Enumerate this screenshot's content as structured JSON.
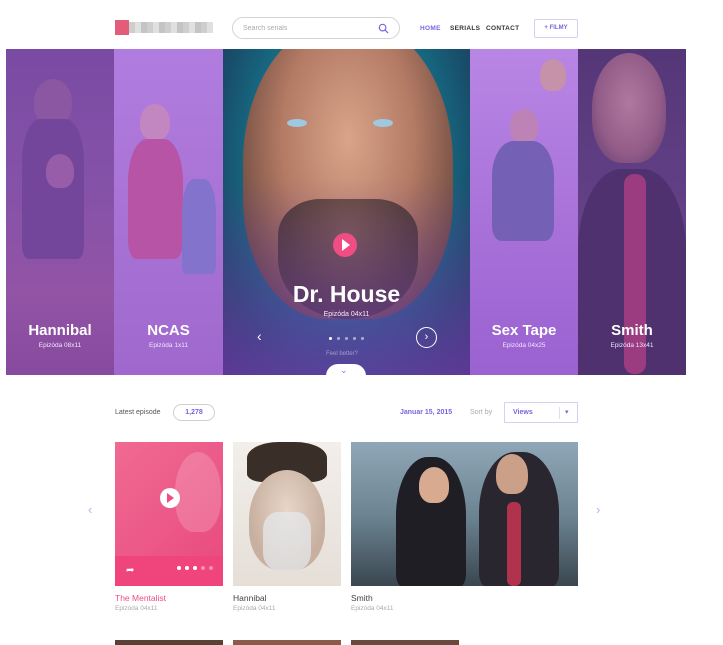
{
  "header": {
    "search_placeholder": "Search serials",
    "nav": [
      {
        "label": "HOME",
        "active": true
      },
      {
        "label": "SERIALS",
        "active": false
      },
      {
        "label": "CONTACT",
        "active": false
      }
    ],
    "filmy_button": "+ FILMY"
  },
  "hero": {
    "slides": [
      {
        "title": "Hannibal",
        "episode": "Epizóda 08x11"
      },
      {
        "title": "NCAS",
        "episode": "Epizóda 1x11"
      },
      {
        "title": "Dr. House",
        "episode": "Epizóda 04x11"
      },
      {
        "title": "Sex Tape",
        "episode": "Epizóda 04x25"
      },
      {
        "title": "Smith",
        "episode": "Epizóda 13x41"
      }
    ],
    "feel_text": "Feel better?",
    "active_dot": 1,
    "dot_count": 5
  },
  "toolbar": {
    "latest_label": "Latest episode",
    "latest_count": "1,278",
    "date": "Januar 15, 2015",
    "sort_label": "Sort by",
    "sort_value": "Views"
  },
  "cards": [
    {
      "title": "The Mentalist",
      "episode": "Epizóda 04x11",
      "rating": 3,
      "rating_max": 5
    },
    {
      "title": "Hannibal",
      "episode": "Epizóda 04x11"
    },
    {
      "title": "Smith",
      "episode": "Epizóda 04x11"
    }
  ],
  "colors": {
    "accent": "#7a64e0",
    "pink": "#ef4d83",
    "hero_tint": "#a05adc"
  }
}
